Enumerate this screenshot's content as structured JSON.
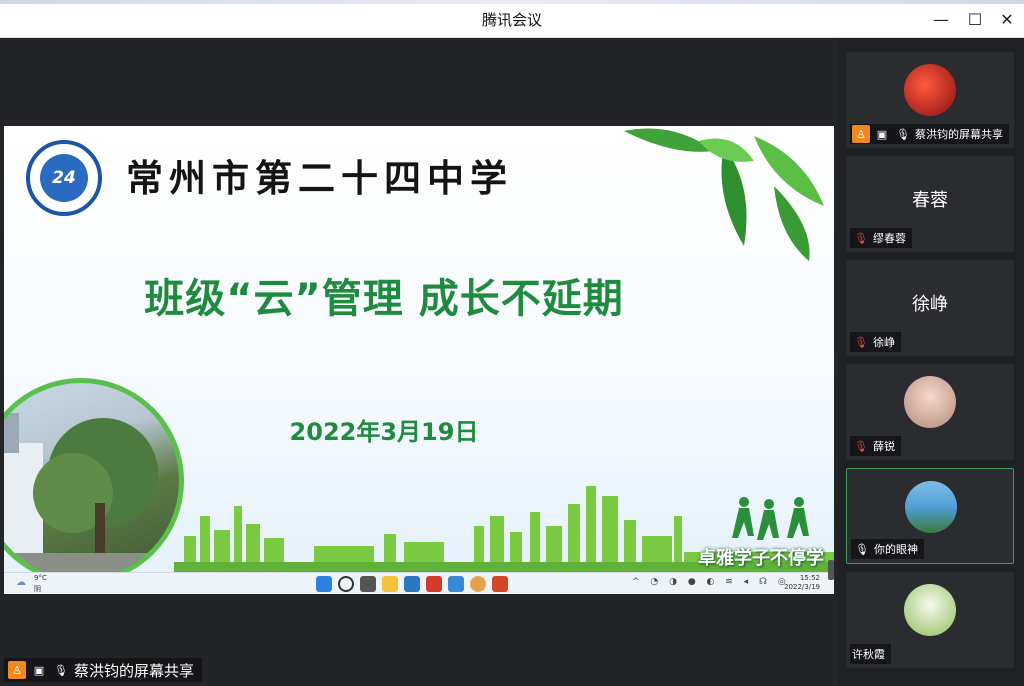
{
  "window": {
    "title": "腾讯会议"
  },
  "slide": {
    "school_name": "常州市第二十四中学",
    "headline": "班级“云”管理   成长不延期",
    "date": "2022年3月19日",
    "tagline": "卓雅学子不停学",
    "logo_text": "24"
  },
  "taskbar": {
    "weather_temp": "9°C",
    "weather_state": "阴",
    "time": "15:52",
    "date": "2022/3/19"
  },
  "share_bar": {
    "label": "蔡洪钧的屏幕共享"
  },
  "participants": [
    {
      "name": "蔡洪钧的屏幕共享",
      "display": "",
      "has_avatar": true,
      "avatar_color": "#c8232a",
      "sharing": true,
      "muted": false
    },
    {
      "name": "缪春蓉",
      "display": "春蓉",
      "has_avatar": false,
      "avatar_color": "",
      "sharing": false,
      "muted": true
    },
    {
      "name": "徐峥",
      "display": "徐峥",
      "has_avatar": false,
      "avatar_color": "",
      "sharing": false,
      "muted": true
    },
    {
      "name": "薛锐",
      "display": "",
      "has_avatar": true,
      "avatar_color": "#e8c8c0",
      "sharing": false,
      "muted": true
    },
    {
      "name": "你的眼神",
      "display": "",
      "has_avatar": true,
      "avatar_color": "#4f9fd6",
      "sharing": false,
      "muted": false
    },
    {
      "name": "许秋霞",
      "display": "",
      "has_avatar": true,
      "avatar_color": "#b9d48a",
      "sharing": false,
      "muted": false
    }
  ],
  "colors": {
    "accent_green": "#1e8b3e",
    "share_orange": "#f08a1e",
    "muted_red": "#e04b3c"
  }
}
